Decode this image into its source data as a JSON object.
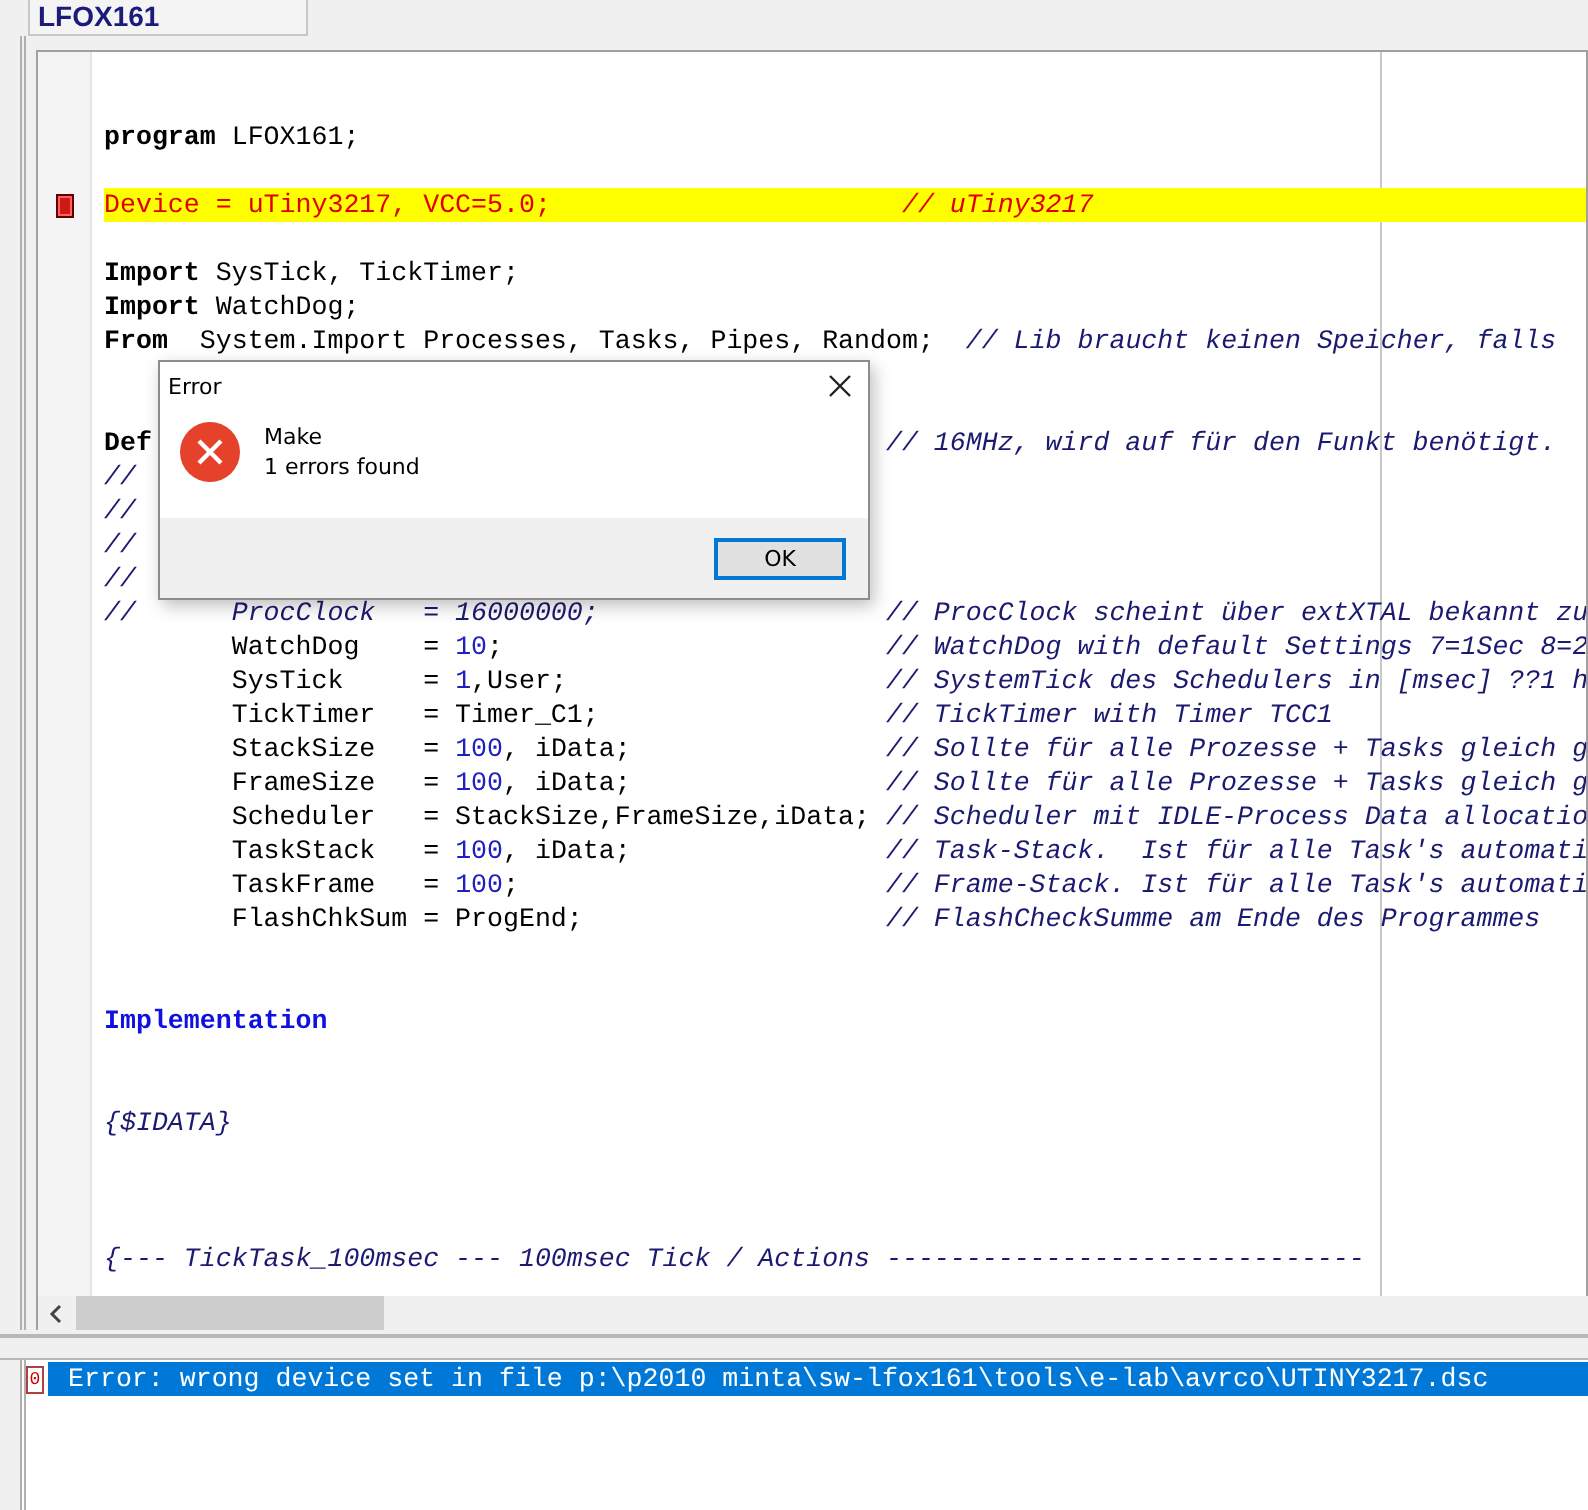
{
  "tab": {
    "label": "LFOX161",
    "selected": true
  },
  "editor": {
    "lines": [
      {
        "kind": "blank"
      },
      {
        "kind": "blank"
      },
      {
        "kind": "code",
        "error": false,
        "segments": [
          {
            "kind": "keyword",
            "text": "program"
          },
          {
            "kind": "plain",
            "text": " LFOX161;"
          }
        ]
      },
      {
        "kind": "blank"
      },
      {
        "kind": "code",
        "error": true,
        "segments": [
          {
            "kind": "plain",
            "text": "Device = uTiny3217, VCC=5.0;                      "
          }
        ],
        "comment": "// uTiny3217"
      },
      {
        "kind": "blank"
      },
      {
        "kind": "code",
        "error": false,
        "segments": [
          {
            "kind": "keyword",
            "text": "Import"
          },
          {
            "kind": "plain",
            "text": " SysTick, TickTimer;"
          }
        ]
      },
      {
        "kind": "code",
        "error": false,
        "segments": [
          {
            "kind": "keyword",
            "text": "Import"
          },
          {
            "kind": "plain",
            "text": " WatchDog;"
          }
        ]
      },
      {
        "kind": "code",
        "error": false,
        "segments": [
          {
            "kind": "keyword",
            "text": "From"
          },
          {
            "kind": "plain",
            "text": "  System.Import Processes, Tasks, Pipes, Random;  "
          }
        ],
        "comment": "// Lib braucht keinen Speicher, falls"
      },
      {
        "kind": "blank"
      },
      {
        "kind": "blank"
      },
      {
        "kind": "partial",
        "error": false,
        "segments": [
          {
            "kind": "keyword",
            "text": "Def"
          }
        ],
        "comment": "// 16MHz, wird auf für den Funkt benötigt."
      },
      {
        "kind": "partial",
        "error": false,
        "segments": [
          {
            "kind": "comment",
            "text": "//"
          }
        ]
      },
      {
        "kind": "partial",
        "error": false,
        "segments": [
          {
            "kind": "comment",
            "text": "//"
          }
        ]
      },
      {
        "kind": "partial",
        "error": false,
        "segments": [
          {
            "kind": "comment",
            "text": "//"
          }
        ]
      },
      {
        "kind": "partial",
        "error": false,
        "segments": [
          {
            "kind": "comment",
            "text": "//"
          }
        ]
      },
      {
        "kind": "code",
        "error": false,
        "segments": [
          {
            "kind": "comment",
            "text": "//      ProcClock   = 16000000;"
          }
        ],
        "comment": "// ProcClock scheint über extXTAL bekannt zu"
      },
      {
        "kind": "code",
        "error": false,
        "segments": [
          {
            "kind": "plain",
            "text": "        WatchDog    = "
          },
          {
            "kind": "number",
            "text": "10"
          },
          {
            "kind": "plain",
            "text": ";"
          }
        ],
        "comment": "// WatchDog with default Settings 7=1Sec 8=2"
      },
      {
        "kind": "code",
        "error": false,
        "segments": [
          {
            "kind": "plain",
            "text": "        SysTick     = "
          },
          {
            "kind": "number",
            "text": "1"
          },
          {
            "kind": "plain",
            "text": ",User;"
          }
        ],
        "comment": "// SystemTick des Schedulers in [msec] ??1 h"
      },
      {
        "kind": "code",
        "error": false,
        "segments": [
          {
            "kind": "plain",
            "text": "        TickTimer   = Timer_C1;"
          }
        ],
        "comment": "// TickTimer with Timer TCC1"
      },
      {
        "kind": "code",
        "error": false,
        "segments": [
          {
            "kind": "plain",
            "text": "        StackSize   = "
          },
          {
            "kind": "number",
            "text": "100"
          },
          {
            "kind": "plain",
            "text": ", iData;"
          }
        ],
        "comment": "// Sollte für alle Prozesse + Tasks gleich g"
      },
      {
        "kind": "code",
        "error": false,
        "segments": [
          {
            "kind": "plain",
            "text": "        FrameSize   = "
          },
          {
            "kind": "number",
            "text": "100"
          },
          {
            "kind": "plain",
            "text": ", iData;"
          }
        ],
        "comment": "// Sollte für alle Prozesse + Tasks gleich g"
      },
      {
        "kind": "code",
        "error": false,
        "segments": [
          {
            "kind": "plain",
            "text": "        Scheduler   = StackSize,FrameSize,iData;"
          }
        ],
        "comment": "// Scheduler mit IDLE-Process Data allocatio"
      },
      {
        "kind": "code",
        "error": false,
        "segments": [
          {
            "kind": "plain",
            "text": "        TaskStack   = "
          },
          {
            "kind": "number",
            "text": "100"
          },
          {
            "kind": "plain",
            "text": ", iData;"
          }
        ],
        "comment": "// Task-Stack.  Ist für alle Task's automati"
      },
      {
        "kind": "code",
        "error": false,
        "segments": [
          {
            "kind": "plain",
            "text": "        TaskFrame   = "
          },
          {
            "kind": "number",
            "text": "100"
          },
          {
            "kind": "plain",
            "text": ";"
          }
        ],
        "comment": "// Frame-Stack. Ist für alle Task's automati"
      },
      {
        "kind": "code",
        "error": false,
        "segments": [
          {
            "kind": "plain",
            "text": "        FlashChkSum = ProgEnd;"
          }
        ],
        "comment": "// FlashCheckSumme am Ende des Programmes"
      },
      {
        "kind": "blank"
      },
      {
        "kind": "blank"
      },
      {
        "kind": "code",
        "error": false,
        "segments": [
          {
            "kind": "section",
            "text": "Implementation"
          }
        ]
      },
      {
        "kind": "blank"
      },
      {
        "kind": "blank"
      },
      {
        "kind": "code",
        "error": false,
        "segments": [
          {
            "kind": "comment",
            "text": "{$IDATA}"
          }
        ]
      },
      {
        "kind": "blank"
      },
      {
        "kind": "blank"
      },
      {
        "kind": "blank"
      },
      {
        "kind": "code",
        "error": false,
        "segments": [
          {
            "kind": "comment",
            "text": "{--- TickTask_100msec --- 100msec Tick / Actions ------------------------------"
          }
        ]
      }
    ]
  },
  "dialog": {
    "title": "Error",
    "caption": "Make",
    "message": "1 errors found",
    "button": "OK"
  },
  "output": {
    "messages": [
      {
        "marker": "0",
        "text": "Error: wrong device set in file p:\\p2010 minta\\sw-lfox161\\tools\\e-lab\\avrco\\UTINY3217.dsc",
        "selected": true
      }
    ]
  }
}
